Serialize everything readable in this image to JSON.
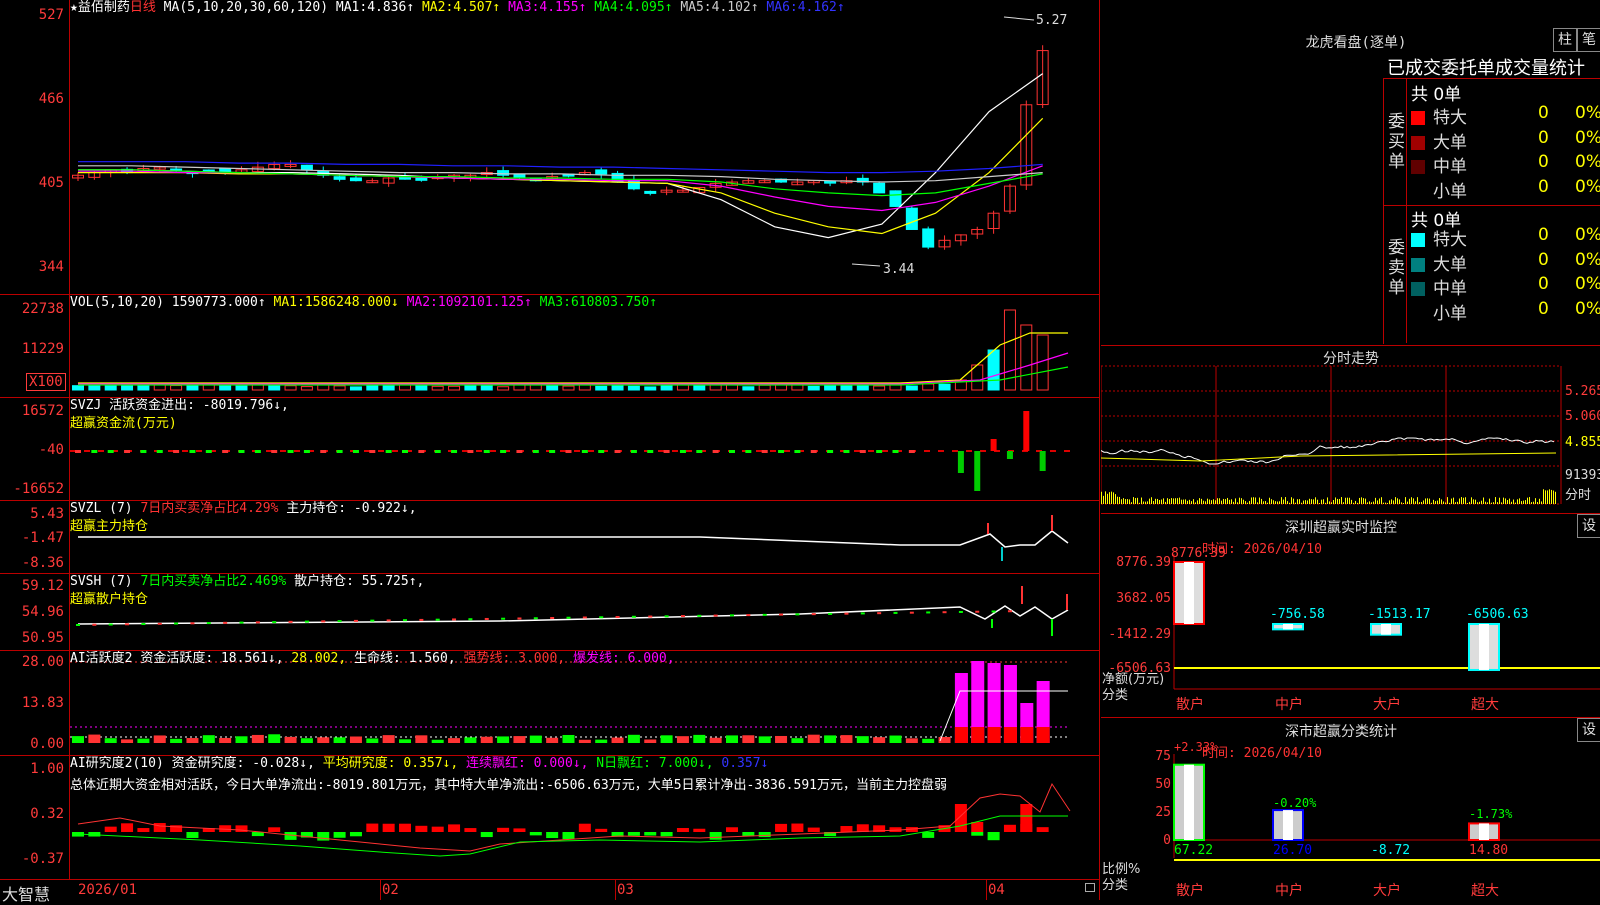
{
  "stock": {
    "name": "★益佰制药",
    "period": "日线"
  },
  "colors": {
    "up": "#ff3333",
    "down": "#00ffff",
    "ma1": "#ffffff",
    "ma2": "#ffff00",
    "ma3": "#ff00ff",
    "ma4": "#00ff00",
    "ma5": "#cccccc",
    "ma6": "#2020ff"
  },
  "main": {
    "params": "MA(5,10,20,30,60,120)",
    "mas": [
      {
        "label": "MA1:",
        "value": "4.836↑",
        "color": "#ffffff"
      },
      {
        "label": "MA2:",
        "value": "4.507↑",
        "color": "#ffff00"
      },
      {
        "label": "MA3:",
        "value": "4.155↑",
        "color": "#ff00ff"
      },
      {
        "label": "MA4:",
        "value": "4.095↑",
        "color": "#00ff00"
      },
      {
        "label": "MA5:",
        "value": "4.102↑",
        "color": "#cccccc"
      },
      {
        "label": "MA6:",
        "value": "4.162↑",
        "color": "#2020ff"
      }
    ],
    "y_labels": [
      "527",
      "466",
      "405",
      "344"
    ],
    "high_label": "5.27",
    "low_label": "3.44"
  },
  "vol": {
    "title": "VOL(5,10,20)",
    "value": "1590773.000↑",
    "mas": [
      {
        "label": "MA1:",
        "value": "1586248.000↓",
        "color": "#ffff00"
      },
      {
        "label": "MA2:",
        "value": "1092101.125↑",
        "color": "#ff00ff"
      },
      {
        "label": "MA3:",
        "value": "610803.750↑",
        "color": "#00ff00"
      }
    ],
    "y_labels": [
      "22738",
      "11229"
    ],
    "unit": "X100"
  },
  "svzj": {
    "line1": "SVZJ  活跃资金进出: -8019.796↓,",
    "line2": "超赢资金流(万元)",
    "y_labels": [
      "16572",
      "-40",
      "-16652"
    ]
  },
  "svzl": {
    "p1": "SVZL (7)",
    "p2": "7日内买卖净占比4.29%",
    "p3": "主力持仓: -0.922↓,",
    "line2": "超赢主力持仓",
    "y_labels": [
      "5.43",
      "-1.47",
      "-8.36"
    ]
  },
  "svsh": {
    "p1": "SVSH (7)",
    "p2": "7日内买卖净占比2.469%",
    "p3": "散户持仓: 55.725↑,",
    "line2": "超赢散户持仓",
    "y_labels": [
      "59.12",
      "54.96",
      "50.95"
    ]
  },
  "ai1": {
    "p1": "AI活跃度2",
    "p2": "资金活跃度: 18.561↓,",
    "p3": "28.002,",
    "p4": "生命线: 1.560,",
    "p5": "强势线: 3.000,",
    "p6": "爆发线: 6.000,",
    "y_labels": [
      "28.00",
      "13.83",
      "0.00"
    ]
  },
  "ai2": {
    "p1": "AI研究度2(10)",
    "p2": "资金研究度: -0.028↓,",
    "p3": "平均研究度: 0.357↓,",
    "p4": "连续飘红: 0.000↓,",
    "p5": "N日飘红: 7.000↓,",
    "p6": "0.357↓",
    "summary": "总体近期大资金相对活跃，今日大单净流出:-8019.801万元，其中特大单净流出:-6506.63万元，大单5日累计净出-3836.591万元，当前主力控盘弱",
    "y_labels": [
      "1.00",
      "0.32",
      "-0.37"
    ]
  },
  "xaxis": {
    "labels": [
      "2026/01",
      "02",
      "03",
      "04"
    ],
    "brand": "大智慧"
  },
  "right": {
    "lhb_title": "龙虎看盘(逐单)",
    "btn_zhu": "柱",
    "btn_bi": "笔",
    "stats_title": "已成交委托单成交量统计",
    "buy_side": "委买单",
    "sell_side": "委卖单",
    "buy_total": "共 0单",
    "sell_total": "共 0单",
    "buy_rows": [
      {
        "label": "特大",
        "count": "0",
        "pct": "0%",
        "color": "#ff0000"
      },
      {
        "label": "大单",
        "count": "0",
        "pct": "0%",
        "color": "#a00000"
      },
      {
        "label": "中单",
        "count": "0",
        "pct": "0%",
        "color": "#600000"
      },
      {
        "label": "小单",
        "count": "0",
        "pct": "0%",
        "color": "#000000"
      }
    ],
    "sell_rows": [
      {
        "label": "特大",
        "count": "0",
        "pct": "0%",
        "color": "#00ffff"
      },
      {
        "label": "大单",
        "count": "0",
        "pct": "0%",
        "color": "#008080"
      },
      {
        "label": "中单",
        "count": "0",
        "pct": "0%",
        "color": "#006060"
      },
      {
        "label": "小单",
        "count": "0",
        "pct": "0%",
        "color": "#000000"
      }
    ],
    "fenshi_title": "分时走势",
    "fenshi_right": [
      "5.265",
      "5.060",
      "4.855",
      "91393"
    ],
    "fenshi_unit": "分时",
    "sz_title": "深圳超赢实时监控",
    "sz_set": "设",
    "sz_time": "时间: 2026/04/10",
    "sz_y": [
      "8776.39",
      "3682.05",
      "-1412.29",
      "-6506.63"
    ],
    "sz_vals": [
      "8776.39",
      "-756.58",
      "-1513.17",
      "-6506.63"
    ],
    "sz_unit1": "净额(万元)",
    "sz_unit2": "分类",
    "categories": [
      "散户",
      "中户",
      "大户",
      "超大"
    ],
    "ss_title": "深市超赢分类统计",
    "ss_set": "设",
    "ss_time": "时间: 2026/04/10",
    "ss_y": [
      "75",
      "50",
      "25",
      "0"
    ],
    "ss_top": [
      "+2.33%",
      "-0.20%",
      "-1.73%"
    ],
    "ss_vals": [
      "67.22",
      "26.70",
      "-8.72",
      "14.80"
    ],
    "ss_unit1": "比例%",
    "ss_unit2": "分类"
  }
}
